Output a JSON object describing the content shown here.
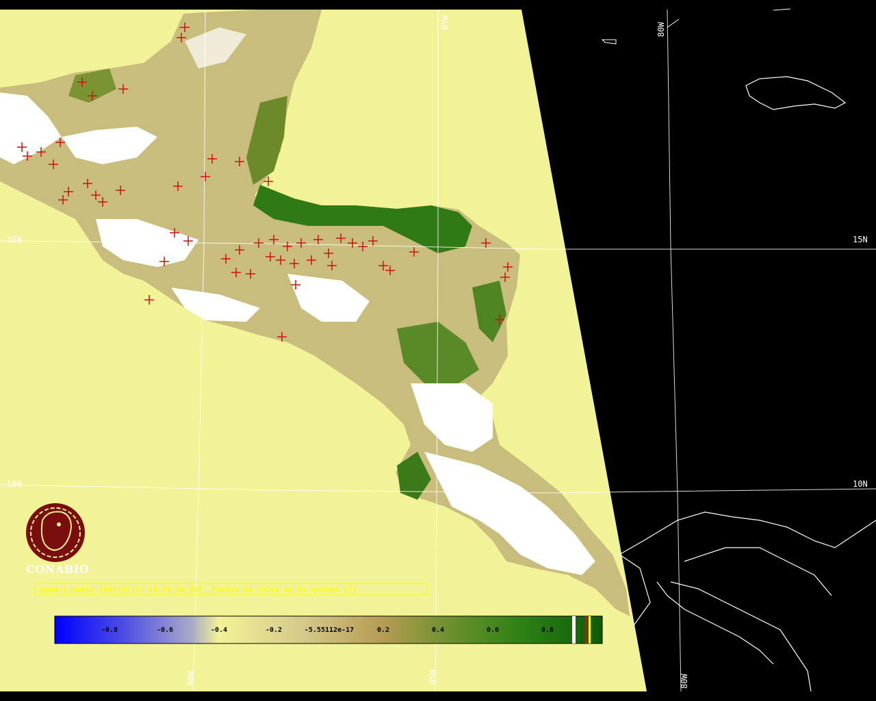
{
  "map": {
    "caption": "aqua-1 modis 2007/05/11 19:26:58 EVI. Puntos de calor en la escena (7)",
    "logo_text": "CONABIO",
    "ocean_color": "#f2f296",
    "background_color": "#000000",
    "coastline_color": "#ffffff",
    "hotspot_color": "#cc1111",
    "grid_labels": {
      "lat_15n": "15N",
      "lat_10n": "10N",
      "lon_85w": "85W",
      "lon_80w": "80W",
      "lon_90w": "90W"
    }
  },
  "legend": {
    "ticks": [
      "-0.8",
      "-0.6",
      "-0.4",
      "-0.2",
      "-5.55112e-17",
      "0.2",
      "0.4",
      "0.6",
      "0.8"
    ],
    "color_stops": [
      "#0000ff",
      "#6b6bd9",
      "#c8c8b0",
      "#f2f296",
      "#d2c886",
      "#b49c52",
      "#7a9432",
      "#2e8214",
      "#0f5a0a"
    ]
  }
}
